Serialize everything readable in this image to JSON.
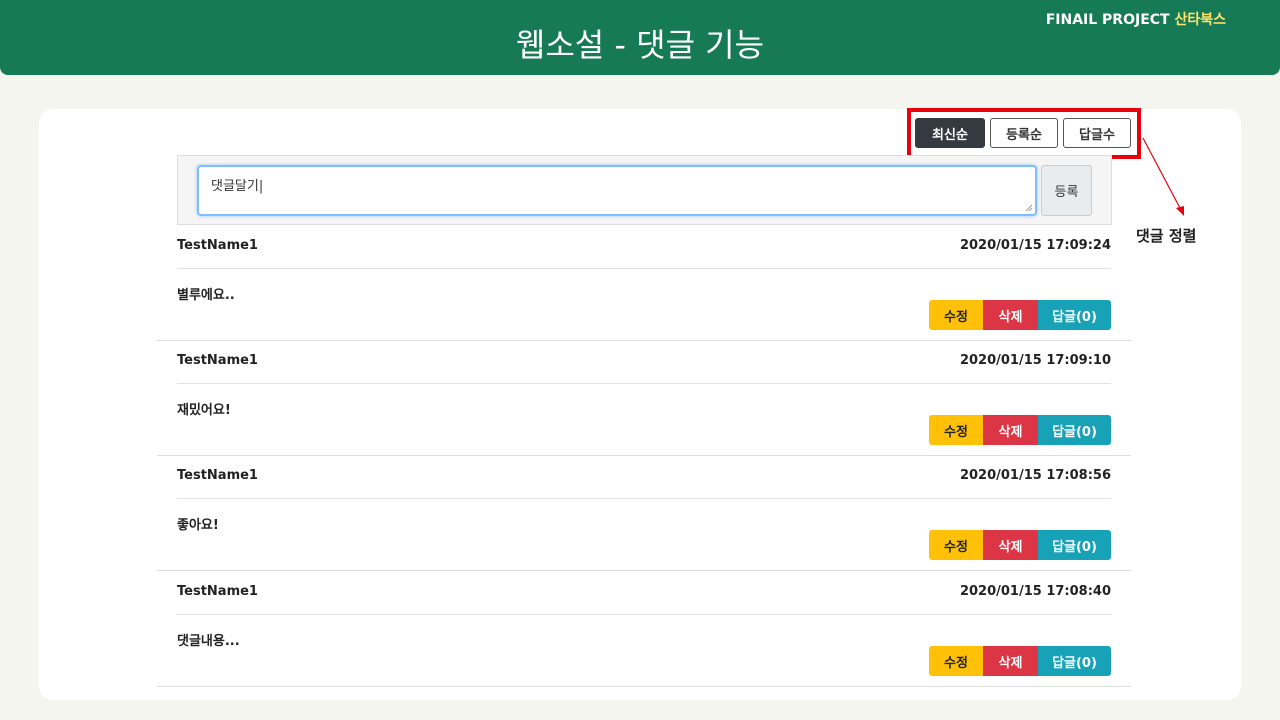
{
  "header": {
    "title": "웹소설 - 댓글 기능",
    "brand_prefix": "FINAIL PROJECT",
    "brand_name": "산타북스"
  },
  "sort": {
    "options": [
      {
        "label": "최신순",
        "active": true
      },
      {
        "label": "등록순",
        "active": false
      },
      {
        "label": "답글수",
        "active": false
      }
    ]
  },
  "annotation": {
    "label": "댓글 정렬"
  },
  "comment_form": {
    "textarea_value": "댓글달기|",
    "submit_label": "등록"
  },
  "comments": [
    {
      "author": "TestName1",
      "date": "2020/01/15 17:09:24",
      "text": "별루에요..",
      "edit": "수정",
      "delete": "삭제",
      "reply": "답글(0)"
    },
    {
      "author": "TestName1",
      "date": "2020/01/15 17:09:10",
      "text": "재밌어요!",
      "edit": "수정",
      "delete": "삭제",
      "reply": "답글(0)"
    },
    {
      "author": "TestName1",
      "date": "2020/01/15 17:08:56",
      "text": "좋아요!",
      "edit": "수정",
      "delete": "삭제",
      "reply": "답글(0)"
    },
    {
      "author": "TestName1",
      "date": "2020/01/15 17:08:40",
      "text": "댓글내용...",
      "edit": "수정",
      "delete": "삭제",
      "reply": "답글(0)"
    }
  ],
  "colors": {
    "header_bg": "#157a55",
    "brand_accent": "#ffe36b",
    "highlight_red": "#e8000d",
    "edit_yellow": "#ffc107",
    "delete_red": "#dc3545",
    "reply_teal": "#17a2b8"
  }
}
